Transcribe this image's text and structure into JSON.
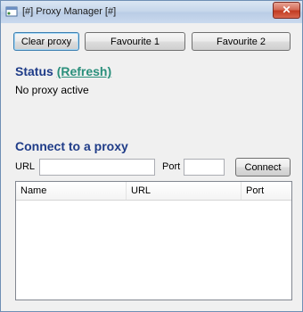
{
  "window": {
    "title": "[#] Proxy Manager [#]",
    "close_glyph": "✕"
  },
  "toolbar": {
    "clear_proxy_label": "Clear proxy",
    "favourite1_label": "Favourite 1",
    "favourite2_label": "Favourite 2"
  },
  "status": {
    "heading": "Status",
    "refresh_link": "(Refresh)",
    "text": "No proxy active"
  },
  "connect": {
    "heading": "Connect to a proxy",
    "url_label": "URL",
    "url_value": "",
    "port_label": "Port",
    "port_value": "",
    "connect_label": "Connect"
  },
  "table": {
    "columns": [
      "Name",
      "URL",
      "Port"
    ],
    "rows": []
  },
  "colors": {
    "heading": "#1f3c88",
    "link": "#2a8f7b",
    "close_button": "#c23b22"
  },
  "icons": {
    "app": "app-window-icon",
    "close": "close-icon"
  }
}
